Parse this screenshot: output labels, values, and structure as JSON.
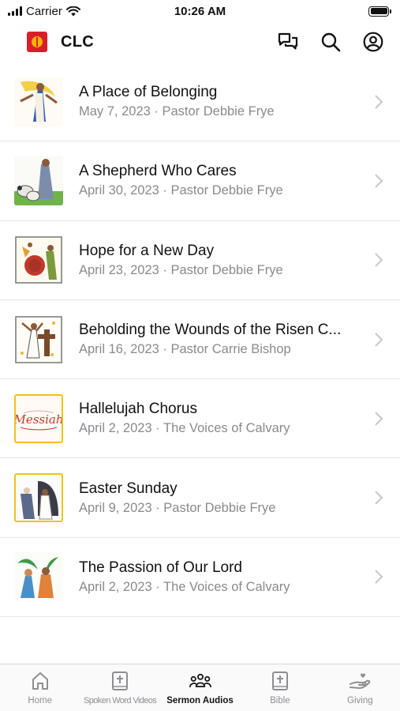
{
  "status_bar": {
    "carrier": "Carrier",
    "time": "10:26 AM"
  },
  "nav": {
    "title": "CLC",
    "logo_color": "#d91e2a",
    "icons": [
      "chat-bubbles-icon",
      "search-icon",
      "account-icon"
    ]
  },
  "sermons": [
    {
      "title": "A Place of Belonging",
      "subtitle": "May 7, 2023 · Pastor Debbie Frye",
      "thumb": "belonging-art"
    },
    {
      "title": "A Shepherd Who Cares",
      "subtitle": "April 30, 2023 · Pastor Debbie Frye",
      "thumb": "shepherd-art"
    },
    {
      "title": "Hope for a New Day",
      "subtitle": "April 23, 2023 · Pastor Debbie Frye",
      "thumb": "new-day-art"
    },
    {
      "title": "Beholding the Wounds of the Risen C...",
      "subtitle": "April 16, 2023 · Pastor Carrie Bishop",
      "thumb": "risen-christ-art"
    },
    {
      "title": "Hallelujah Chorus",
      "subtitle": "April 2, 2023 · The Voices of Calvary",
      "thumb": "messiah-art"
    },
    {
      "title": "Easter Sunday",
      "subtitle": "April 9, 2023 · Pastor Debbie Frye",
      "thumb": "easter-art"
    },
    {
      "title": "The Passion of Our Lord",
      "subtitle": "April 2, 2023 · The Voices of Calvary",
      "thumb": "palm-sunday-art"
    }
  ],
  "tabs": [
    {
      "label": "Home",
      "icon": "home-icon",
      "active": false
    },
    {
      "label": "Spoken Word Videos",
      "icon": "book-cross-icon",
      "active": false
    },
    {
      "label": "Sermon Audios",
      "icon": "people-icon",
      "active": true
    },
    {
      "label": "Bible",
      "icon": "bible-icon",
      "active": false
    },
    {
      "label": "Giving",
      "icon": "giving-hand-icon",
      "active": false
    }
  ],
  "colors": {
    "accent_border": "#f0c21a",
    "subtitle": "#8a8a8e",
    "tab_inactive": "#8e8e93"
  }
}
